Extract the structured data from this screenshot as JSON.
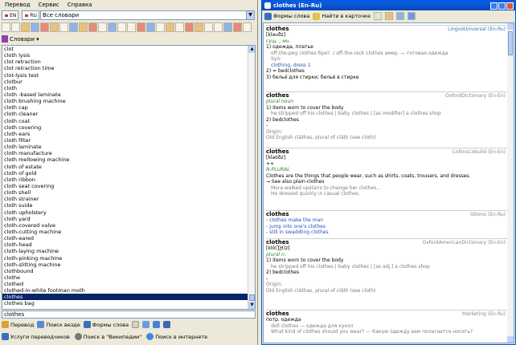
{
  "menu": [
    "Перевод",
    "Сервис",
    "Справка"
  ],
  "lang_from": "EN",
  "lang_to": "RU",
  "dict_select": "Все словари",
  "slovari_label": "Словари",
  "words": [
    "clot",
    "cloth lysis",
    "clot retraction",
    "clot retraction time",
    "clot-lysis test",
    "clotbur",
    "cloth",
    "cloth -based laminate",
    "cloth brushing machine",
    "cloth cap",
    "cloth cleaner",
    "cloth coat",
    "cloth covering",
    "cloth ears",
    "cloth filter",
    "cloth laminate",
    "cloth manufacture",
    "cloth mellowing machine",
    "cloth of estate",
    "cloth of gold",
    "cloth ribbon",
    "cloth seat covering",
    "cloth shell",
    "cloth strainer",
    "cloth suide",
    "cloth upholstery",
    "cloth yard",
    "cloth-covered valve",
    "cloth-cutting machine",
    "cloth-eared",
    "cloth-head",
    "cloth-laying machine",
    "cloth-pinking machine",
    "cloth-slitting machine",
    "clothbound",
    "clothe",
    "clothed",
    "clothed-in-white footman moth",
    "clothes",
    "clothes bag"
  ],
  "selected_word": "clothes",
  "search_text": "clothes",
  "bottom1": [
    "Перевод",
    "Поиск везде",
    "Формы слова"
  ],
  "bottom2": [
    "Услуги переводчиков",
    "Поиск в \"Википедии\"",
    "Поиск в интернете"
  ],
  "right": {
    "title": "clothes (En-Ru)",
    "toolbar": [
      "Формы слова",
      "Найти в карточке"
    ],
    "cards": [
      {
        "hw": "clothes",
        "src": "LingvoUniversal (En-Ru)",
        "lines": [
          {
            "t": "[kləuðz]",
            "c": ""
          },
          {
            "t": "сущ. ; мн.",
            "c": "green"
          },
          {
            "t": "1) одежда, платье",
            "c": ""
          },
          {
            "t": "off-the-peg clothes брит. / off-the-rack clothes амер. — готовая одежда",
            "c": "gray ind"
          },
          {
            "t": "Syn:",
            "c": "gray ind"
          },
          {
            "t": "clothing, dress 1",
            "c": "blue ind"
          },
          {
            "t": "2) = bedclothes",
            "c": ""
          },
          {
            "t": "3) бельё для стирки; бельё в стирке",
            "c": ""
          }
        ]
      },
      {
        "hw": "clothes",
        "src": "OxfordDictionary (En-En)",
        "lines": [
          {
            "t": "plural noun",
            "c": "green"
          },
          {
            "t": "1) items worn to cover the body",
            "c": ""
          },
          {
            "t": "he stripped off his clothes | baby clothes | [as modifier] a clothes shop",
            "c": "gray ind"
          },
          {
            "t": "2) bedclothes",
            "c": ""
          },
          {
            "t": "-",
            "c": ""
          },
          {
            "t": "Origin:",
            "c": "gray"
          },
          {
            "t": "Old English clāthas, plural of clāth (see cloth)",
            "c": "gray"
          }
        ]
      },
      {
        "hw": "clothes",
        "src": "CollinsCobuild (En-En)",
        "lines": [
          {
            "t": "[kləʊðz]",
            "c": ""
          },
          {
            "t": "++",
            "c": ""
          },
          {
            "t": "N-PLURAL",
            "c": "green"
          },
          {
            "t": "Clothes are the things that people wear, such as shirts, coats, trousers, and dresses.",
            "c": ""
          },
          {
            "t": "→ See also plain-clothes",
            "c": ""
          },
          {
            "t": "Mora walked upstairs to change her clothes...",
            "c": "gray ind"
          },
          {
            "t": "He dressed quickly in casual clothes.",
            "c": "gray ind"
          }
        ]
      },
      {
        "hw": "clothes",
        "src": "Idioms (En-Ru)",
        "lines": [
          {
            "t": "- clothes make the man",
            "c": "blue"
          },
          {
            "t": "- jump into one's clothes",
            "c": "blue"
          },
          {
            "t": "- still in swaddling clothes",
            "c": "blue"
          }
        ]
      },
      {
        "hw": "clothes",
        "src": "OxfordAmericanDictionary (En-En)",
        "lines": [
          {
            "t": "[klō(T͟H)z]",
            "c": ""
          },
          {
            "t": "plural n.",
            "c": "green"
          },
          {
            "t": "1) items worn to cover the body",
            "c": ""
          },
          {
            "t": "he stripped off his clothes | baby clothes | [as adj.] a clothes shop",
            "c": "gray ind"
          },
          {
            "t": "2) bedclothes",
            "c": ""
          },
          {
            "t": "-",
            "c": ""
          },
          {
            "t": "Origin:",
            "c": "gray"
          },
          {
            "t": "Old English clāthas, plural of clāth (see cloth)",
            "c": "gray"
          }
        ]
      },
      {
        "hw": "clothes",
        "src": "Marketing (En-Ru)",
        "lines": [
          {
            "t": "потр. одежда",
            "c": ""
          },
          {
            "t": "doll clothes — одежда для кукол",
            "c": "gray ind"
          },
          {
            "t": "What kind of clothes should you wear? — Какую одежду вам полагается носить?",
            "c": "gray ind"
          }
        ]
      }
    ]
  }
}
